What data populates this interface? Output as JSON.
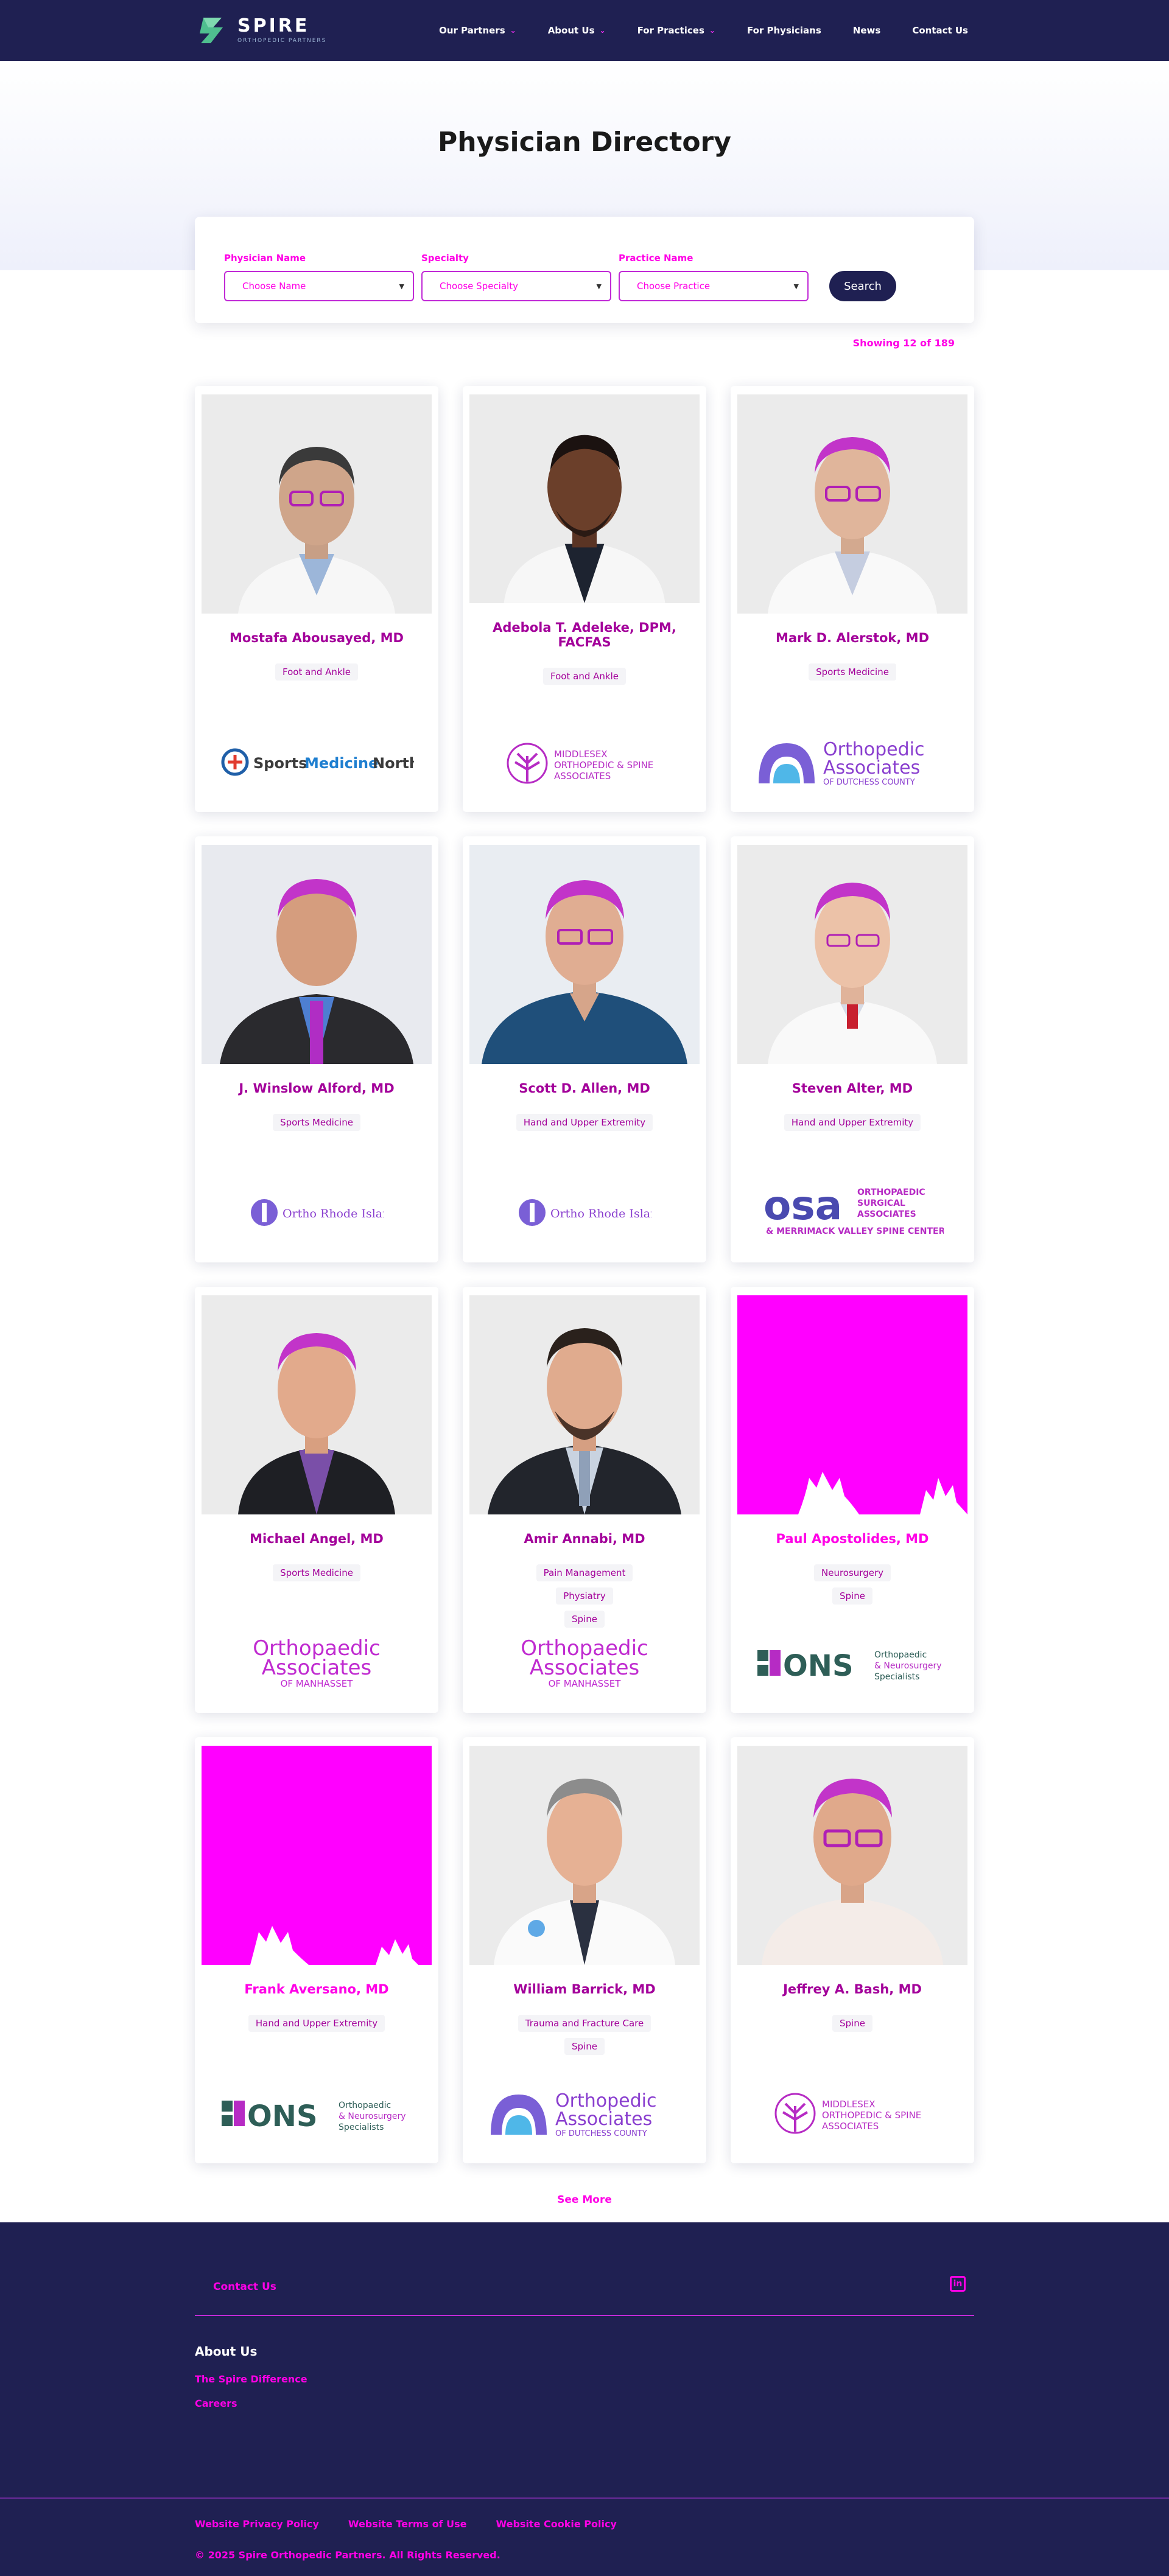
{
  "nav": {
    "logo": {
      "name": "SPIRE",
      "tagline": "ORTHOPEDIC PARTNERS"
    },
    "items": [
      {
        "label": "Our Partners",
        "dropdown": true
      },
      {
        "label": "About Us",
        "dropdown": true
      },
      {
        "label": "For Practices",
        "dropdown": true
      },
      {
        "label": "For Physicians",
        "dropdown": false
      },
      {
        "label": "News",
        "dropdown": false
      },
      {
        "label": "Contact Us",
        "dropdown": false
      }
    ]
  },
  "hero": {
    "title": "Physician Directory"
  },
  "filters": {
    "name": {
      "label": "Physician Name",
      "value": "Choose Name"
    },
    "specialty": {
      "label": "Specialty",
      "value": "Choose Specialty"
    },
    "practice": {
      "label": "Practice Name",
      "value": "Choose Practice"
    },
    "search_label": "Search"
  },
  "showing": "Showing 12 of 189",
  "physicians": [
    {
      "name": "Mostafa Abousayed, MD",
      "specialties": [
        "Foot and Ankle"
      ],
      "practice": "Sports Medicine North",
      "photo": "portrait"
    },
    {
      "name": "Adebola T. Adeleke, DPM, FACFAS",
      "specialties": [
        "Foot and Ankle"
      ],
      "practice": "Middlesex Orthopedic & Spine Associates",
      "photo": "portrait"
    },
    {
      "name": "Mark D. Alerstok, MD",
      "specialties": [
        "Sports Medicine"
      ],
      "practice": "Orthopedic Associates of Dutchess County",
      "photo": "portrait"
    },
    {
      "name": "J. Winslow Alford, MD",
      "specialties": [
        "Sports Medicine"
      ],
      "practice": "Ortho Rhode Island",
      "photo": "portrait"
    },
    {
      "name": "Scott D. Allen, MD",
      "specialties": [
        "Hand and Upper Extremity"
      ],
      "practice": "Ortho Rhode Island",
      "photo": "portrait"
    },
    {
      "name": "Steven Alter, MD",
      "specialties": [
        "Hand and Upper Extremity"
      ],
      "practice": "OSA Orthopaedic Surgical Associates & Merrimack Valley Spine Center",
      "photo": "portrait"
    },
    {
      "name": "Michael Angel, MD",
      "specialties": [
        "Sports Medicine"
      ],
      "practice": "Orthopaedic Associates of Manhasset",
      "photo": "portrait"
    },
    {
      "name": "Amir Annabi, MD",
      "specialties": [
        "Pain Management",
        "Physiatry",
        "Spine"
      ],
      "practice": "Orthopaedic Associates of Manhasset",
      "photo": "portrait"
    },
    {
      "name": "Paul Apostolides, MD",
      "specialties": [
        "Neurosurgery",
        "Spine"
      ],
      "practice": "ONS Orthopaedic & Neurosurgery Specialists",
      "photo": "magenta"
    },
    {
      "name": "Frank Aversano, MD",
      "specialties": [
        "Hand and Upper Extremity"
      ],
      "practice": "ONS Orthopaedic & Neurosurgery Specialists",
      "photo": "magenta"
    },
    {
      "name": "William Barrick, MD",
      "specialties": [
        "Trauma and Fracture Care",
        "Spine"
      ],
      "practice": "Orthopedic Associates of Dutchess County",
      "photo": "portrait"
    },
    {
      "name": "Jeffrey A. Bash, MD",
      "specialties": [
        "Spine"
      ],
      "practice": "Middlesex Orthopedic & Spine Associates",
      "photo": "portrait"
    }
  ],
  "logos": {
    "smn": {
      "a": "Sports",
      "b": "Medicine",
      "c": "North"
    },
    "mosa": {
      "l1": "MIDDLESEX",
      "l2": "ORTHOPEDIC & SPINE",
      "l3": "ASSOCIATES"
    },
    "oadc": {
      "l1": "Orthopedic",
      "l2": "Associates",
      "l3": "OF DUTCHESS COUNTY"
    },
    "ori": {
      "l1": "Ortho Rhode Island"
    },
    "osa": {
      "mark": "osa",
      "l1": "ORTHOPAEDIC",
      "l2": "SURGICAL",
      "l3": "ASSOCIATES",
      "l4": "& MERRIMACK VALLEY SPINE CENTER"
    },
    "oam": {
      "l1": "Orthopaedic",
      "l2": "Associates",
      "l3": "OF MANHASSET"
    },
    "ons": {
      "mark": "ONS",
      "l1": "Orthopaedic",
      "l2": "& Neurosurgery",
      "l3": "Specialists"
    }
  },
  "see_more": "See More",
  "footer": {
    "contact": "Contact Us",
    "linkedin": "in",
    "about_heading": "About Us",
    "about_links": [
      "The Spire Difference",
      "Careers"
    ],
    "legal": [
      "Website Privacy Policy",
      "Website Terms of Use",
      "Website Cookie Policy"
    ],
    "copyright": "© 2025 Spire Orthopedic Partners. All Rights Reserved."
  },
  "colors": {
    "navy": "#1f2052",
    "magenta": "#ff00e6",
    "deep_magenta": "#a3009a"
  }
}
